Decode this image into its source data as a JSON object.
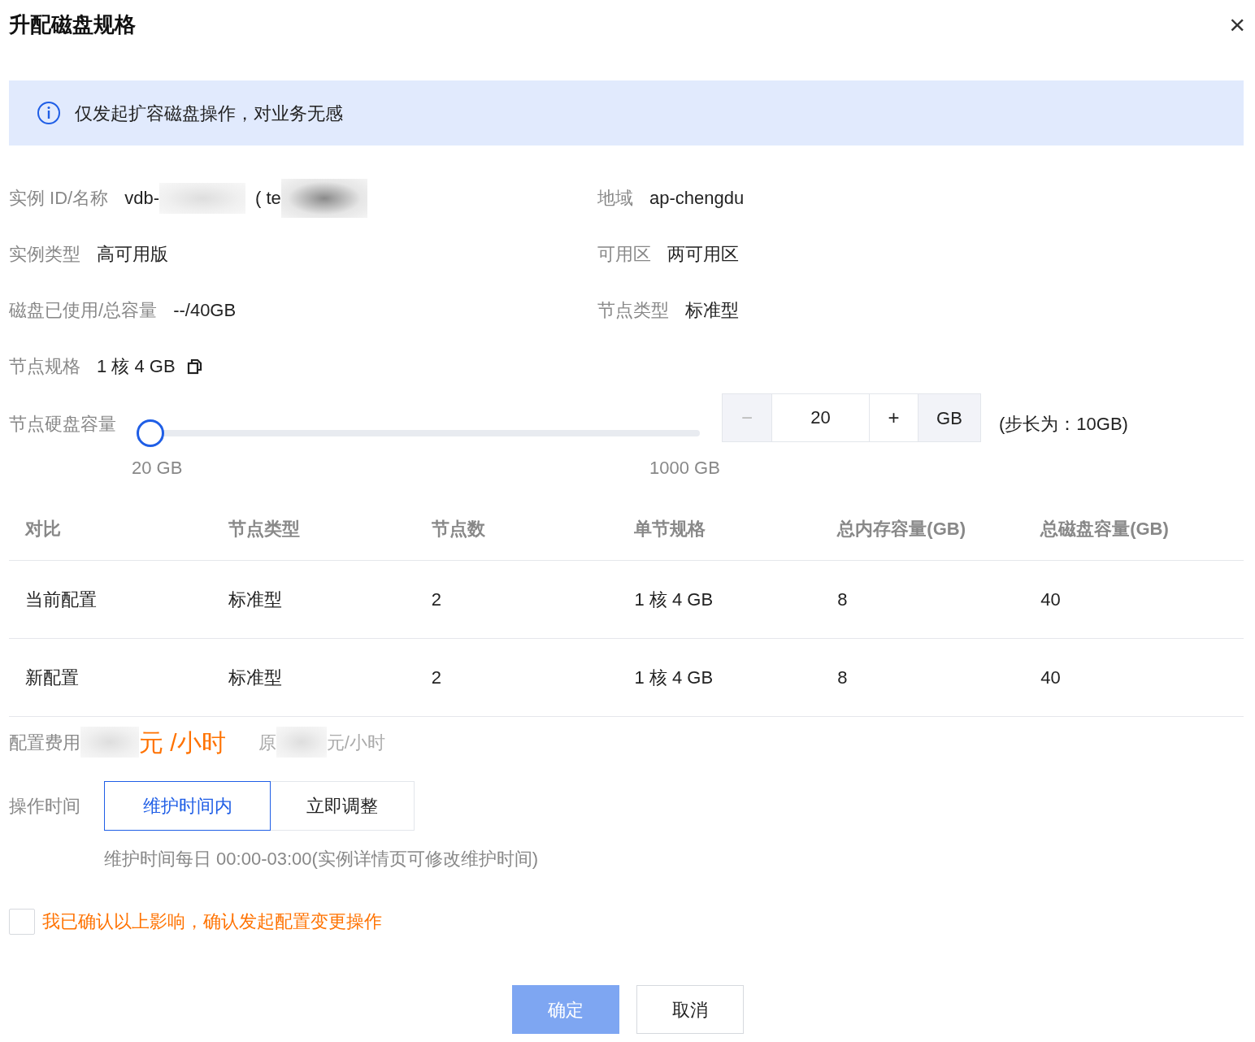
{
  "dialog": {
    "title": "升配磁盘规格",
    "close": "×"
  },
  "notice": {
    "text": "仅发起扩容磁盘操作，对业务无感"
  },
  "info": [
    {
      "label": "实例 ID/名称",
      "kind": "instance",
      "parts": [
        "vdb-",
        "( te"
      ]
    },
    {
      "label": "地域",
      "kind": "text",
      "value": "ap-chengdu"
    },
    {
      "label": "实例类型",
      "kind": "text",
      "value": "高可用版"
    },
    {
      "label": "可用区",
      "kind": "text",
      "value": "两可用区"
    },
    {
      "label": "磁盘已使用/总容量",
      "kind": "text",
      "value": "--/40GB"
    },
    {
      "label": "节点类型",
      "kind": "text",
      "value": "标准型"
    },
    {
      "label": "节点规格",
      "kind": "copy",
      "value": "1 核 4 GB"
    }
  ],
  "disk": {
    "label": "节点硬盘容量",
    "level": 0,
    "min_label": "20 GB",
    "max_label": "1000 GB",
    "minus": "−",
    "value": "20",
    "plus": "+",
    "unit": "GB",
    "step_note": "(步长为：10GB)"
  },
  "table": {
    "columns": [
      "对比",
      "节点类型",
      "节点数",
      "单节规格",
      "总内存容量(GB)",
      "总磁盘容量(GB)"
    ],
    "rows": [
      [
        "当前配置",
        "标准型",
        "2",
        "1 核 4 GB",
        "8",
        "40"
      ],
      [
        "新配置",
        "标准型",
        "2",
        "1 核 4 GB",
        "8",
        "40"
      ]
    ]
  },
  "cost": {
    "label": "配置费用",
    "price_unit": "元 /小时",
    "original_prefix": "原",
    "original_unit": "元/小时"
  },
  "op_time": {
    "label": "操作时间",
    "options": [
      {
        "label": "维护时间内",
        "selected": true
      },
      {
        "label": "立即调整",
        "selected": false
      }
    ],
    "hint": "维护时间每日 00:00-03:00(实例详情页可修改维护时间)"
  },
  "confirm": {
    "checked": false,
    "text": "我已确认以上影响，确认发起配置变更操作"
  },
  "buttons": [
    {
      "label": "确定",
      "kind": "primary",
      "disabled": true
    },
    {
      "label": "取消",
      "kind": "secondary",
      "disabled": false
    }
  ]
}
